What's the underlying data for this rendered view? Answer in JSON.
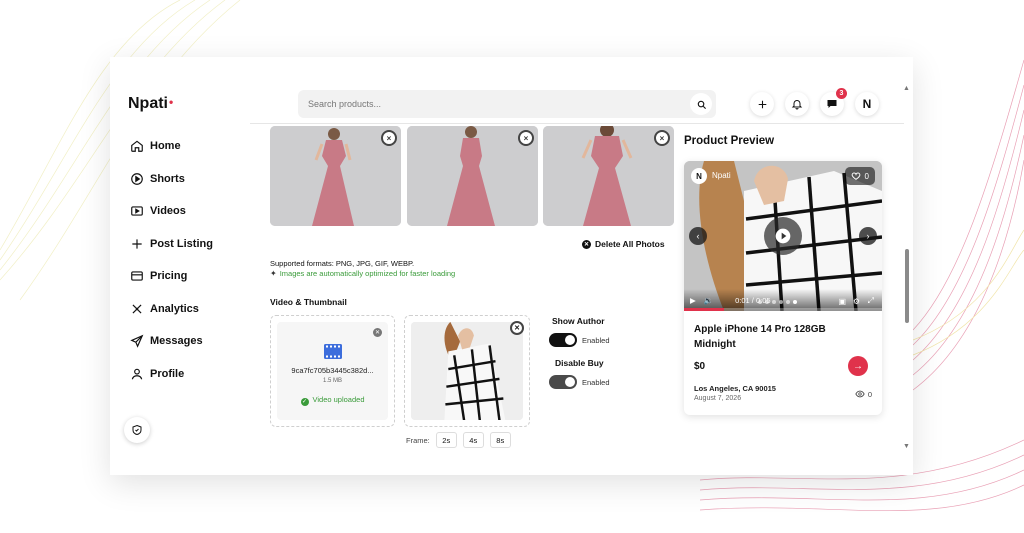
{
  "app": {
    "logo": "Npati",
    "logo_dot": "•"
  },
  "sidebar": {
    "items": [
      {
        "label": "Home",
        "icon": "home-icon"
      },
      {
        "label": "Shorts",
        "icon": "play-circle-icon"
      },
      {
        "label": "Videos",
        "icon": "video-icon"
      },
      {
        "label": "Post Listing",
        "icon": "plus-icon"
      },
      {
        "label": "Pricing",
        "icon": "card-icon"
      },
      {
        "label": "Analytics",
        "icon": "analytics-icon"
      },
      {
        "label": "Messages",
        "icon": "send-icon"
      },
      {
        "label": "Profile",
        "icon": "user-icon"
      }
    ]
  },
  "header": {
    "search_placeholder": "Search products...",
    "messages_badge": "3",
    "avatar_initial": "N"
  },
  "photos": {
    "delete_all_label": "Delete All Photos",
    "formats_text": "Supported formats: PNG, JPG, GIF, WEBP.",
    "optimized_text": "Images are automatically optimized for faster loading",
    "remove_glyph": "×"
  },
  "video": {
    "section_label": "Video & Thumbnail",
    "file_name": "9ca7fc705b3445c382d...",
    "file_size": "1.5 MB",
    "status": "Video uploaded",
    "frame_label": "Frame:",
    "frame_options": [
      "2s",
      "4s",
      "8s"
    ]
  },
  "settings": {
    "show_author_label": "Show Author",
    "show_author_state": "Enabled",
    "disable_buy_label": "Disable Buy",
    "disable_buy_state": "Enabled"
  },
  "preview": {
    "title": "Product Preview",
    "author_initial": "N",
    "author_name": "Npati",
    "likes": "0",
    "time": "0:01 / 0:05",
    "progress": 0.2,
    "product_name": "Apple iPhone 14 Pro 128GB Midnight",
    "price": "$0",
    "location": "Los Angeles, CA 90015",
    "date": "August 7, 2026",
    "views": "0"
  },
  "colors": {
    "accent": "#e0324b",
    "success": "#3a9b3a",
    "dress": "#c87a86"
  }
}
